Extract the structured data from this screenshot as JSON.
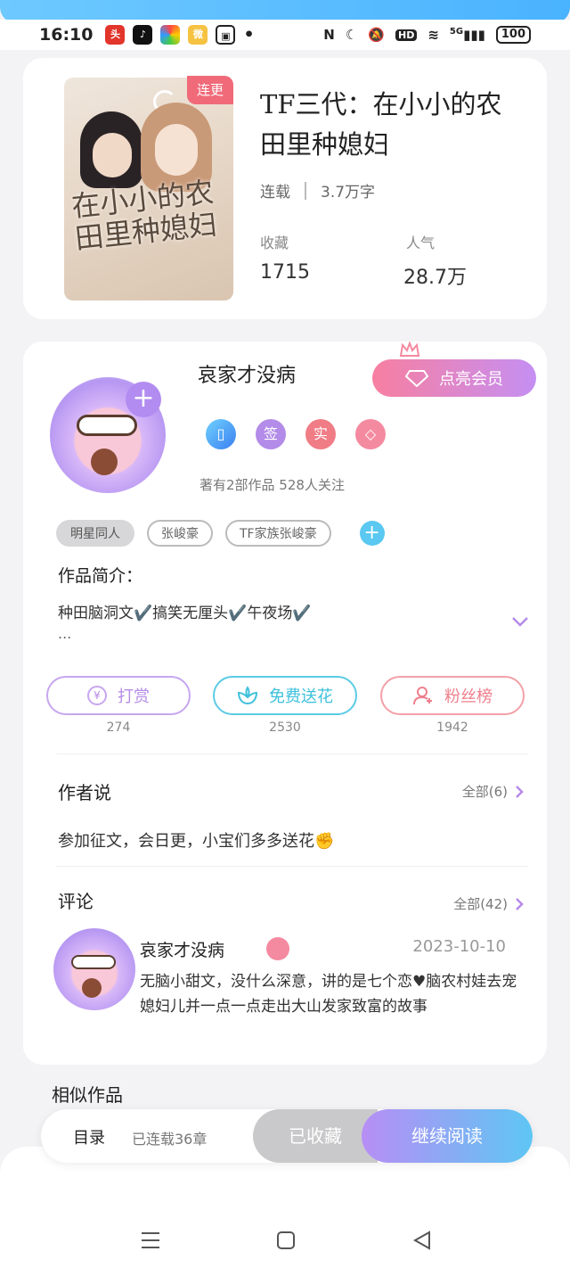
{
  "status_bar": {
    "time": "16:10",
    "network": "5G",
    "battery": "100"
  },
  "book": {
    "status_tag": "连更",
    "title": "TF三代：在小小的农田里种媳妇",
    "status": "连载",
    "word_count": "3.7万字",
    "favorites_label": "收藏",
    "favorites_value": "1715",
    "popularity_label": "人气",
    "popularity_value": "28.7万",
    "cover_text": "在小小的农田里种媳妇"
  },
  "author": {
    "name": "哀家才没病",
    "vip_button": "点亮会员",
    "badges": [
      "签",
      "实"
    ],
    "stats": "著有2部作品 528人关注",
    "tags": [
      "明星同人",
      "张峻豪",
      "TF家族张峻豪"
    ],
    "intro_label": "作品简介：",
    "intro_text": "种田脑洞文✔️搞笑无厘头✔️午夜场✔️",
    "intro_more": "..."
  },
  "actions": [
    {
      "label": "打赏",
      "count": "274",
      "color": "#b58be8"
    },
    {
      "label": "免费送花",
      "count": "2530",
      "color": "#4cc6e0"
    },
    {
      "label": "粉丝榜",
      "count": "1942",
      "color": "#f08a96"
    }
  ],
  "author_says": {
    "title": "作者说",
    "all": "全部(6)",
    "text": "参加征文，会日更，小宝们多多送花✊"
  },
  "comments": {
    "title": "评论",
    "all": "全部(42)",
    "item": {
      "name": "哀家才没病",
      "date": "2023-10-10",
      "text": "无脑小甜文，没什么深意，讲的是七个恋♥脑农村娃去宠媳妇儿并一点一点走出大山发家致富的故事"
    }
  },
  "similar_title": "相似作品",
  "bottom_bar": {
    "toc": "目录",
    "toc_sub": "已连载36章",
    "favorited": "已收藏",
    "continue": "继续阅读"
  }
}
